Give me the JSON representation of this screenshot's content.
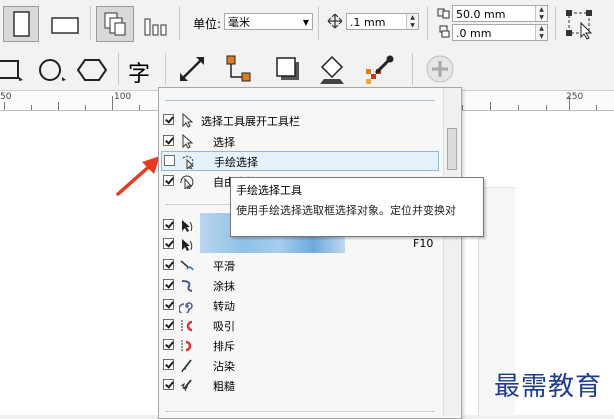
{
  "toolbar1": {
    "unit_label": "单位:",
    "unit_value": "毫米",
    "nudge_value": ".1 mm",
    "dup_x_value": "50.0 mm",
    "dup_y_value": ".0 mm"
  },
  "toolbar2": {
    "text_tool_glyph": "字"
  },
  "ruler": {
    "labels": [
      "50",
      "100",
      "250"
    ]
  },
  "menu": {
    "items": [
      {
        "label": "选择工具展开工具栏",
        "checked": true,
        "icon": "pointer-icon"
      },
      {
        "label": "选择",
        "checked": true,
        "icon": "pointer-icon"
      },
      {
        "label": "手绘选择",
        "checked": false,
        "icon": "freehand-pick-icon"
      },
      {
        "label": "自由变换",
        "checked": true,
        "icon": "free-transform-icon"
      },
      {
        "label": "",
        "checked": true,
        "icon": "shape-tool-icon"
      },
      {
        "label": "",
        "checked": true,
        "icon": "shape-tool-icon",
        "shortcut": "F10"
      },
      {
        "label": "平滑",
        "checked": true,
        "icon": "smooth-icon"
      },
      {
        "label": "涂抹",
        "checked": true,
        "icon": "smear-icon"
      },
      {
        "label": "转动",
        "checked": true,
        "icon": "twirl-icon"
      },
      {
        "label": "吸引",
        "checked": true,
        "icon": "attract-icon"
      },
      {
        "label": "排斥",
        "checked": true,
        "icon": "repel-icon"
      },
      {
        "label": "沾染",
        "checked": true,
        "icon": "smudge-icon"
      },
      {
        "label": "粗糙",
        "checked": true,
        "icon": "roughen-icon"
      }
    ]
  },
  "tooltip": {
    "title": "手绘选择工具",
    "body": "使用手绘选择选取框选择对象。定位并变换对"
  },
  "watermark": "最需教育",
  "colors": {
    "arrow": "#e43a1f",
    "watermark": "#1c3c8c",
    "highlight": "#e5f1fb"
  }
}
